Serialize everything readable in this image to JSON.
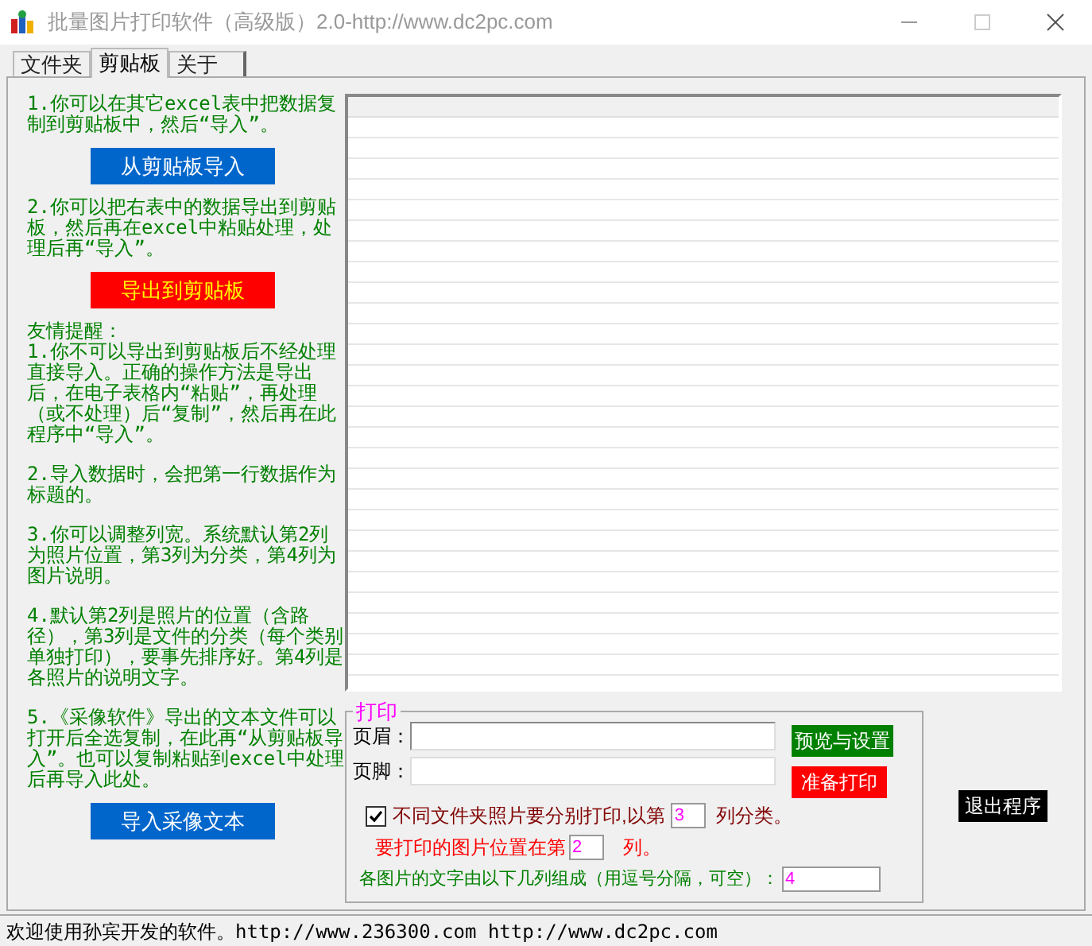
{
  "window": {
    "title": "批量图片打印软件（高级版）2.0-http://www.dc2pc.com"
  },
  "tabs": [
    {
      "label": "文件夹",
      "selected": false
    },
    {
      "label": "剪贴板",
      "selected": true
    },
    {
      "label": "关于",
      "selected": false
    }
  ],
  "clipboard_panel": {
    "blocks": [
      {
        "kind": "text",
        "text": "1.你可以在其它excel表中把数据复制到剪贴板中，然后“导入”。"
      },
      {
        "kind": "button",
        "text": "从剪贴板导入",
        "color": "#0066cc"
      },
      {
        "kind": "text",
        "text": "2.你可以把右表中的数据导出到剪贴板，然后再在excel中粘贴处理，处理后再“导入”。"
      },
      {
        "kind": "button",
        "text": "导出到剪贴板",
        "color": "#ff0000"
      },
      {
        "kind": "tips",
        "heading": "友情提醒：",
        "items": [
          "1.你不可以导出到剪贴板后不经处理直接导入。正确的操作方法是导出后，在电子表格内“粘贴”，再处理（或不处理）后“复制”，然后再在此程序中“导入”。",
          "2.导入数据时，会把第一行数据作为标题的。",
          "3.你可以调整列宽。系统默认第2列为照片位置，第3列为分类，第4列为图片说明。",
          "4.默认第2列是照片的位置（含路径），第3列是文件的分类（每个类别单独打印），要事先排序好。第4列是各照片的说明文字。",
          "5.《采像软件》导出的文本文件可以打开后全选复制，在此再“从剪贴板导入”。也可以复制粘贴到excel中处理后再导入此处。"
        ]
      },
      {
        "kind": "button",
        "text": "导入采像文本",
        "color": "#0066cc"
      }
    ]
  },
  "print_group": {
    "title": "打印",
    "header_label": "页眉：",
    "footer_label": "页脚：",
    "preview_button": "预览与设置",
    "print_button": "准备打印",
    "separate_option": {
      "checked": true,
      "label_before": "不同文件夹照片要分别打印,以第",
      "value": "3",
      "label_after": "列分类。"
    },
    "image_column": {
      "label_before": "要打印的图片位置在第",
      "value": "2",
      "label_after": "列。"
    },
    "caption_columns": {
      "label": "各图片的文字由以下几列组成（用逗号分隔，可空）：",
      "value": "4"
    }
  },
  "exit_button": "退出程序",
  "status_bar": {
    "text": "欢迎使用孙宾开发的软件。http://www.236300.com http://www.dc2pc.com"
  }
}
